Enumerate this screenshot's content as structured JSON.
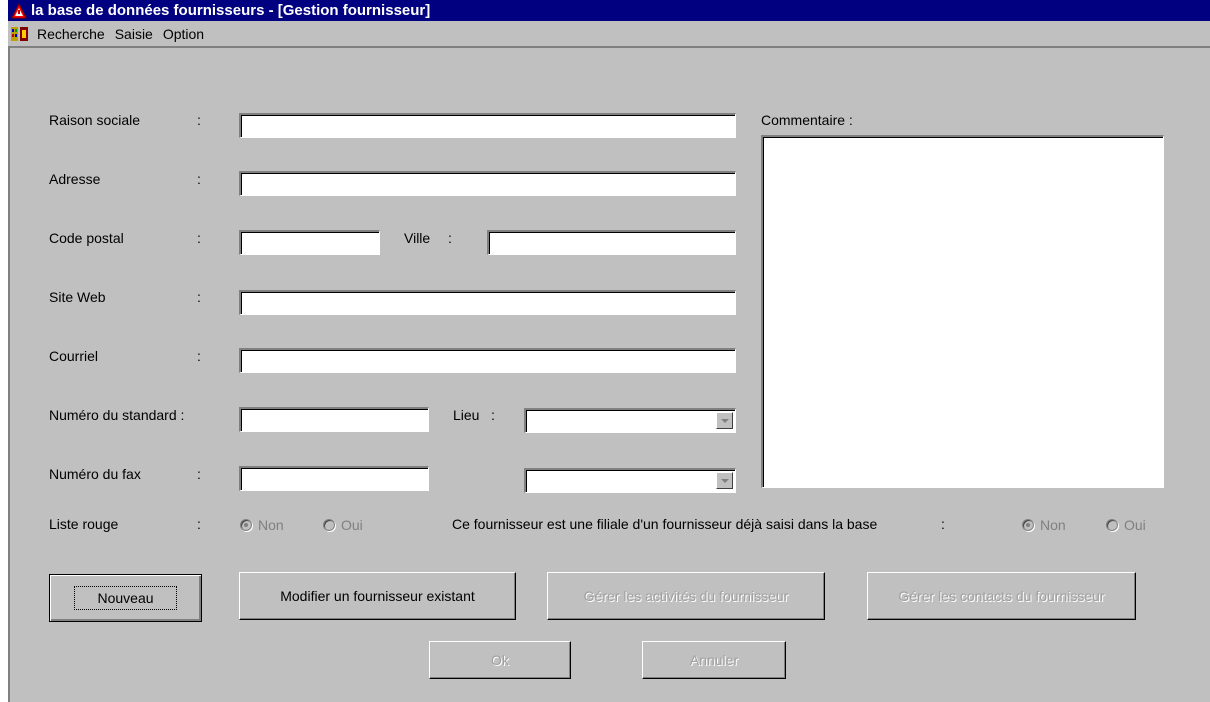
{
  "window": {
    "title": "la base de données fournisseurs - [Gestion fournisseur]"
  },
  "menu": {
    "items": [
      "Recherche",
      "Saisie",
      "Option"
    ]
  },
  "form": {
    "raison_sociale": {
      "label": "Raison sociale",
      "colon": ":",
      "value": ""
    },
    "adresse": {
      "label": "Adresse",
      "colon": ":",
      "value": ""
    },
    "code_postal": {
      "label": "Code postal",
      "colon": ":",
      "value": ""
    },
    "ville": {
      "label": "Ville",
      "colon": ":",
      "value": ""
    },
    "site_web": {
      "label": "Site Web",
      "colon": ":",
      "value": ""
    },
    "courriel": {
      "label": "Courriel",
      "colon": ":",
      "value": ""
    },
    "numero_standard": {
      "label": "Numéro du standard :",
      "value": ""
    },
    "lieu": {
      "label": "Lieu",
      "colon": ":",
      "value": ""
    },
    "numero_fax": {
      "label": "Numéro du fax",
      "colon": ":",
      "value": "",
      "lieu_value": ""
    },
    "liste_rouge": {
      "label": "Liste rouge",
      "colon": ":",
      "options": [
        "Non",
        "Oui"
      ],
      "selected": "Non"
    },
    "filiale": {
      "label": "Ce fournisseur est une filiale d'un fournisseur déjà saisi dans la base",
      "colon": ":",
      "options": [
        "Non",
        "Oui"
      ],
      "selected": "Non"
    },
    "commentaire": {
      "label": "Commentaire :",
      "value": ""
    }
  },
  "buttons": {
    "nouveau": "Nouveau",
    "modifier": "Modifier un fournisseur existant",
    "activites": "Gérer les activités du fournisseur",
    "contacts": "Gérer les contacts du fournisseur",
    "ok": "Ok",
    "annuler": "Annuler"
  },
  "colors": {
    "titlebar": "#000080",
    "face": "#c0c0c0",
    "disabled_text": "#a0a0a0"
  }
}
